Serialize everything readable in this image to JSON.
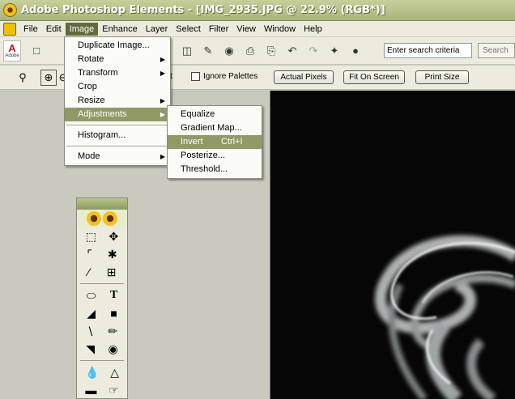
{
  "window": {
    "title": "Adobe Photoshop Elements - [IMG_2935.JPG @ 22.9% (RGB*)]"
  },
  "menubar": {
    "items": [
      "File",
      "Edit",
      "Image",
      "Enhance",
      "Layer",
      "Select",
      "Filter",
      "View",
      "Window",
      "Help"
    ],
    "active": "Image"
  },
  "toolbar": {
    "adobe_label": "Adobe",
    "search": {
      "value": "Enter search criteria",
      "button": "Search"
    }
  },
  "options": {
    "partial_label": "t",
    "ignore_palettes": "Ignore Palettes",
    "actual_pixels": "Actual Pixels",
    "fit_on_screen": "Fit On Screen",
    "print_size": "Print Size"
  },
  "image_menu": {
    "items": [
      {
        "label": "Duplicate Image...",
        "submenu": false
      },
      {
        "label": "Rotate",
        "submenu": true
      },
      {
        "label": "Transform",
        "submenu": true
      },
      {
        "label": "Crop",
        "submenu": false
      },
      {
        "label": "Resize",
        "submenu": true
      },
      {
        "label": "Adjustments",
        "submenu": true,
        "highlighted": true
      },
      {
        "label": "Histogram...",
        "submenu": false
      },
      {
        "label": "Mode",
        "submenu": true
      }
    ]
  },
  "adjustments_menu": {
    "items": [
      {
        "label": "Equalize"
      },
      {
        "label": "Gradient Map..."
      },
      {
        "label": "Invert",
        "shortcut": "Ctrl+I",
        "highlighted": true
      },
      {
        "label": "Posterize..."
      },
      {
        "label": "Threshold..."
      }
    ]
  },
  "colors": {
    "title_bar": "#a9b57c",
    "menu_active": "#616b3d",
    "menu_highlight": "#8f9a67",
    "canvas": "#060606"
  }
}
